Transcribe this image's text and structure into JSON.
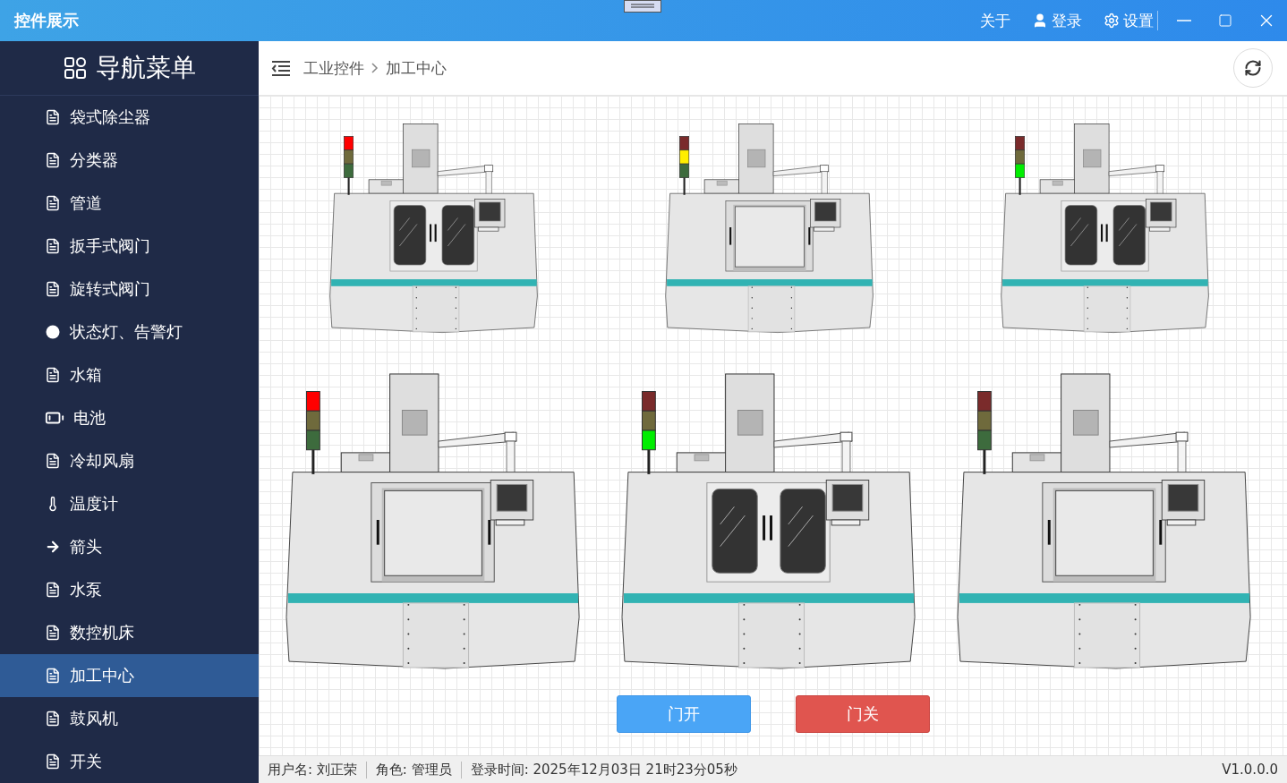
{
  "window": {
    "title": "控件展示"
  },
  "title_bar": {
    "links": [
      "关于",
      "登录",
      "设置"
    ]
  },
  "sidebar": {
    "title": "导航菜单",
    "items": [
      {
        "label": "袋式除尘器",
        "kind": "file",
        "selected": false
      },
      {
        "label": "分类器",
        "kind": "file",
        "selected": false
      },
      {
        "label": "管道",
        "kind": "file",
        "selected": false
      },
      {
        "label": "扳手式阀门",
        "kind": "file",
        "selected": false
      },
      {
        "label": "旋转式阀门",
        "kind": "file",
        "selected": false
      },
      {
        "label": "状态灯、告警灯",
        "kind": "dot",
        "selected": false
      },
      {
        "label": "水箱",
        "kind": "file",
        "selected": false
      },
      {
        "label": "电池",
        "kind": "battery",
        "selected": false
      },
      {
        "label": "冷却风扇",
        "kind": "file",
        "selected": false
      },
      {
        "label": "温度计",
        "kind": "thermometer",
        "selected": false
      },
      {
        "label": "箭头",
        "kind": "arrow",
        "selected": false
      },
      {
        "label": "水泵",
        "kind": "file",
        "selected": false
      },
      {
        "label": "数控机床",
        "kind": "file",
        "selected": false
      },
      {
        "label": "加工中心",
        "kind": "file",
        "selected": true
      },
      {
        "label": "鼓风机",
        "kind": "file",
        "selected": false
      },
      {
        "label": "开关",
        "kind": "file",
        "selected": false
      }
    ]
  },
  "breadcrumb": [
    "工业控件",
    "加工中心"
  ],
  "machine_rows": [
    [
      {
        "red_on": true,
        "yellow_on": false,
        "green_on": false,
        "door_open": false
      },
      {
        "red_on": false,
        "yellow_on": true,
        "green_on": false,
        "door_open": true
      },
      {
        "red_on": false,
        "yellow_on": false,
        "green_on": true,
        "door_open": false
      }
    ],
    [
      {
        "red_on": true,
        "yellow_on": false,
        "green_on": false,
        "door_open": true
      },
      {
        "red_on": false,
        "yellow_on": false,
        "green_on": true,
        "door_open": false
      },
      {
        "red_on": false,
        "yellow_on": false,
        "green_on": false,
        "door_open": true
      }
    ]
  ],
  "buttons": [
    {
      "label": "门开",
      "kind": "primary"
    },
    {
      "label": "门关",
      "kind": "danger"
    }
  ],
  "status_bar": {
    "fields": [
      "用户名: 刘正荣",
      "角色: 管理员",
      "登录时间: 2025年12月03日 21时23分05秒"
    ],
    "version": "V1.0.0.0"
  }
}
